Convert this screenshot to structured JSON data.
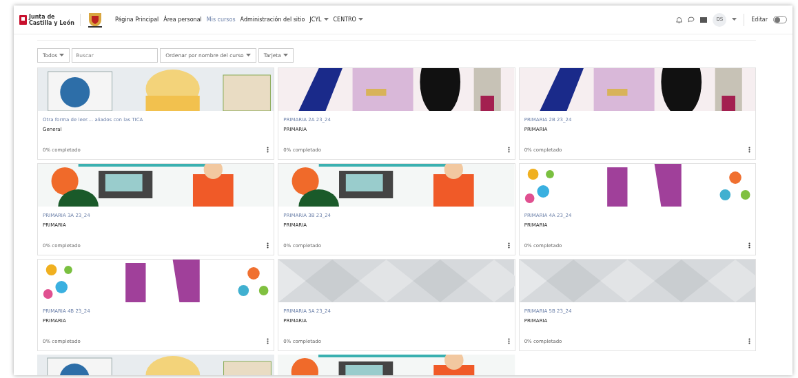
{
  "logo": {
    "line_1": "Junta de",
    "line_2": "Castilla y León"
  },
  "nav": [
    {
      "label": "Página Principal",
      "selected": false,
      "dropdown": false
    },
    {
      "label": "Área personal",
      "selected": false,
      "dropdown": false
    },
    {
      "label": "Mis cursos",
      "selected": true,
      "dropdown": false
    },
    {
      "label": "Administración del sitio",
      "selected": false,
      "dropdown": false
    },
    {
      "label": "JCYL",
      "selected": false,
      "dropdown": true
    },
    {
      "label": "CENTRO",
      "selected": false,
      "dropdown": true
    }
  ],
  "user": {
    "initials": "DS"
  },
  "edit_mode": {
    "label": "Editar",
    "on": false
  },
  "filters": {
    "grouping": "Todos",
    "search_placeholder": "Buscar",
    "sort": "Ordenar por nombre del curso",
    "view": "Tarjeta"
  },
  "courses": [
    {
      "title": "Otra forma de leer.... aliados con las TICA",
      "category": "General",
      "progress": "0% completado"
    },
    {
      "title": "PRIMARIA 2A 23_24",
      "category": "PRIMARIA",
      "progress": "0% completado"
    },
    {
      "title": "PRIMARIA 2B 23_24",
      "category": "PRIMARIA",
      "progress": "0% completado"
    },
    {
      "title": "PRIMARIA 3A 23_24",
      "category": "PRIMARIA",
      "progress": "0% completado"
    },
    {
      "title": "PRIMARIA 3B 23_24",
      "category": "PRIMARIA",
      "progress": "0% completado"
    },
    {
      "title": "PRIMARIA 4A 23_24",
      "category": "PRIMARIA",
      "progress": "0% completado"
    },
    {
      "title": "PRIMARIA 4B 23_24",
      "category": "PRIMARIA",
      "progress": "0% completado"
    },
    {
      "title": "PRIMARIA 5A 23_24",
      "category": "PRIMARIA",
      "progress": "0% completado"
    },
    {
      "title": "PRIMARIA 5B 23_24",
      "category": "PRIMARIA",
      "progress": "0% completado"
    },
    {
      "kind": "picture"
    },
    {
      "kind": "picture"
    }
  ]
}
